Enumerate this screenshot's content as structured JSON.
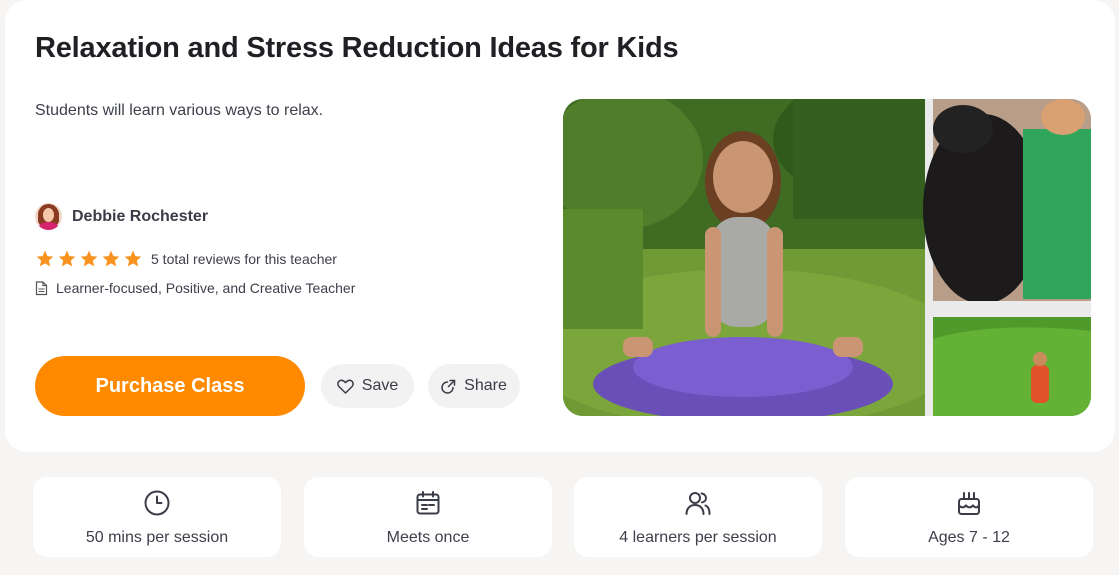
{
  "class": {
    "title": "Relaxation and Stress Reduction Ideas for Kids",
    "description": "Students will learn various ways to relax."
  },
  "teacher": {
    "name": "Debbie Rochester",
    "rating_stars": 5,
    "reviews_text": "5 total reviews for this teacher",
    "tagline": "Learner-focused, Positive, and Creative Teacher"
  },
  "actions": {
    "purchase_label": "Purchase Class",
    "save_label": "Save",
    "share_label": "Share"
  },
  "stats": [
    {
      "icon": "clock-icon",
      "label": "50 mins per session"
    },
    {
      "icon": "calendar-icon",
      "label": "Meets once"
    },
    {
      "icon": "users-icon",
      "label": "4 learners per session"
    },
    {
      "icon": "cake-icon",
      "label": "Ages 7 - 12"
    }
  ],
  "colors": {
    "accent": "#ff8a00",
    "star": "#f7931e",
    "background": "#f6f5f4"
  }
}
